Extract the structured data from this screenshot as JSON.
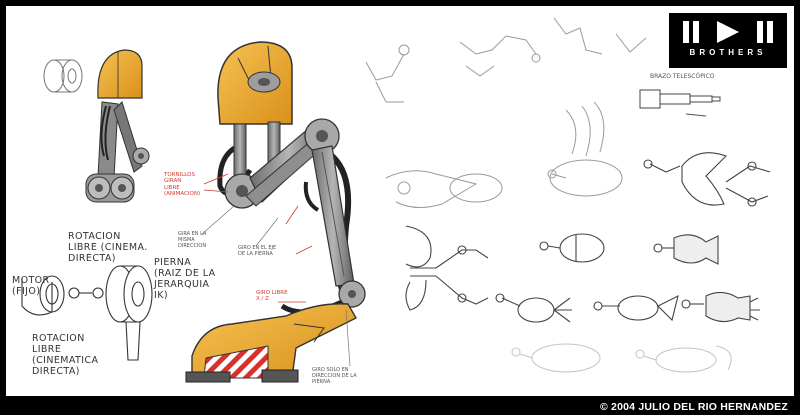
{
  "logo": {
    "text": "BROTHERS",
    "icon": "pause-play-pause-icon"
  },
  "copyright": "© 2004 JULIO DEL RIO HERNANDEZ",
  "annotations": {
    "rotacion_libre_top": "ROTACION\nLIBRE  (CINEMA.\nDIRECTA)",
    "motor": "MOTOR\n(FIJO)",
    "pierna": "PIERNA\n(RAIZ DE LA\nJERARQUIA\nIK)",
    "rotacion_libre_bottom": "ROTACION\nLIBRE\n(CINEMATICA\nDIRECTA)",
    "brazo_telescopico": "BRAZO TELESCÓPICO",
    "red_note_1": "TORNILLOS\nGIRAN\nLIBRE\n(ANIMACION)",
    "red_note_2": "GIRO LIBRE\nX / Z",
    "gray_note_1": "GIRA EN LA\nMISMA\nDIRECCION",
    "gray_note_2": "GIRO EN EL EJE\nDE LA PIERNA",
    "gray_note_3": "GIRO SOLO EN\nDIRECCION DE LA\nPIERNA"
  },
  "colors": {
    "accent_yellow": "#f0a81c",
    "stripe_red": "#d8302a",
    "metal_gray": "#9a9a9a",
    "dark_gray": "#4a4a4a",
    "annotation_red": "#d23a2e"
  }
}
